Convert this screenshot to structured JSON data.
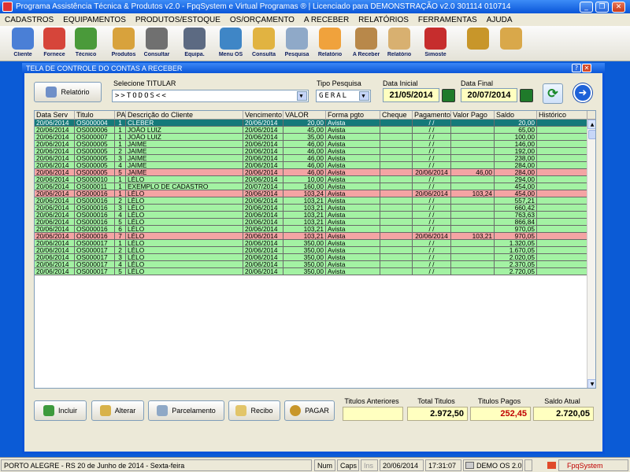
{
  "window": {
    "title": "Programa Assistência Técnica & Produtos v2.0 - FpqSystem e Virtual Programas ® | Licenciado para  DEMONSTRAÇÃO v2.0 301114 010714"
  },
  "menu": [
    "CADASTROS",
    "EQUIPAMENTOS",
    "PRODUTOS/ESTOQUE",
    "OS/ORÇAMENTO",
    "A RECEBER",
    "RELATÓRIOS",
    "FERRAMENTAS",
    "AJUDA"
  ],
  "toolbar": [
    {
      "label": "Cliente",
      "color": "#4a7fd6"
    },
    {
      "label": "Fornece",
      "color": "#d6453a"
    },
    {
      "label": "Técnico",
      "color": "#4a9a3a"
    },
    {
      "label": "Produtos",
      "color": "#d8a23c"
    },
    {
      "label": "Consultar",
      "color": "#707070"
    },
    {
      "label": "Equipa.",
      "color": "#5c6a82"
    },
    {
      "label": "Menu OS",
      "color": "#3f86c6"
    },
    {
      "label": "Consulta",
      "color": "#e1b341"
    },
    {
      "label": "Pesquisa",
      "color": "#8fa9c8"
    },
    {
      "label": "Relatório",
      "color": "#f0a23c"
    },
    {
      "label": "A Receber",
      "color": "#b8884a"
    },
    {
      "label": "Relatório",
      "color": "#d8b070"
    },
    {
      "label": "Simoste",
      "color": "#c62d2d"
    },
    {
      "label": "",
      "color": "#c8962a"
    },
    {
      "label": "",
      "color": "#d9a84a"
    }
  ],
  "dialog": {
    "title": "TELA DE CONTROLE DO CONTAS A RECEBER",
    "relatorio_button": "Relatório",
    "titular_label": "Selecione TITULAR",
    "titular_value": ">>TODOS<<",
    "tipo_label": "Tipo Pesquisa",
    "tipo_value": "GERAL",
    "data_inicial_label": "Data Inicial",
    "data_inicial": "21/05/2014",
    "data_final_label": "Data Final",
    "data_final": "20/07/2014"
  },
  "table": {
    "headers": [
      "Data Serv",
      "Titulo",
      "PA",
      "Descrição do Cliente",
      "Vencimento",
      "VALOR",
      "Forma pgto",
      "Cheque",
      "Pagamento",
      "Valor Pago",
      "Saldo",
      "Histórico"
    ],
    "rows": [
      {
        "s": "sel",
        "c": [
          "20/06/2014",
          "OS000004",
          "1",
          "CLEBER",
          "20/06/2014",
          "20,00",
          "Avista",
          "",
          " / /",
          "",
          "20,00",
          ""
        ]
      },
      {
        "s": "g",
        "c": [
          "20/06/2014",
          "OS000006",
          "1",
          "JOÃO  LUIZ",
          "20/06/2014",
          "45,00",
          "Avista",
          "",
          " / /",
          "",
          "65,00",
          ""
        ]
      },
      {
        "s": "g",
        "c": [
          "20/06/2014",
          "OS000007",
          "1",
          "JOÃO  LUIZ",
          "20/06/2014",
          "35,00",
          "Avista",
          "",
          " / /",
          "",
          "100,00",
          ""
        ]
      },
      {
        "s": "g",
        "c": [
          "20/06/2014",
          "OS000005",
          "1",
          "JAIME",
          "20/06/2014",
          "46,00",
          "Avista",
          "",
          " / /",
          "",
          "146,00",
          ""
        ]
      },
      {
        "s": "g",
        "c": [
          "20/06/2014",
          "OS000005",
          "2",
          "JAIME",
          "20/06/2014",
          "46,00",
          "Avista",
          "",
          " / /",
          "",
          "192,00",
          ""
        ]
      },
      {
        "s": "g",
        "c": [
          "20/06/2014",
          "OS000005",
          "3",
          "JAIME",
          "20/06/2014",
          "46,00",
          "Avista",
          "",
          " / /",
          "",
          "238,00",
          ""
        ]
      },
      {
        "s": "g",
        "c": [
          "20/06/2014",
          "OS000005",
          "4",
          "JAIME",
          "20/06/2014",
          "46,00",
          "Avista",
          "",
          " / /",
          "",
          "284,00",
          ""
        ]
      },
      {
        "s": "p",
        "c": [
          "20/06/2014",
          "OS000005",
          "5",
          "JAIME",
          "20/06/2014",
          "46,00",
          "Avista",
          "",
          "20/06/2014",
          "46,00",
          "284,00",
          ""
        ]
      },
      {
        "s": "g",
        "c": [
          "20/06/2014",
          "OS000010",
          "1",
          "LÉLO",
          "20/06/2014",
          "10,00",
          "Avista",
          "",
          " / /",
          "",
          "294,00",
          ""
        ]
      },
      {
        "s": "g",
        "c": [
          "20/06/2014",
          "OS000011",
          "1",
          "EXEMPLO DE CADASTRO",
          "20/07/2014",
          "160,00",
          "Avista",
          "",
          " / /",
          "",
          "454,00",
          ""
        ]
      },
      {
        "s": "p",
        "c": [
          "20/06/2014",
          "OS000016",
          "1",
          "LÉLO",
          "20/06/2014",
          "103,24",
          "Avista",
          "",
          "20/06/2014",
          "103,24",
          "454,00",
          ""
        ]
      },
      {
        "s": "g",
        "c": [
          "20/06/2014",
          "OS000016",
          "2",
          "LÉLO",
          "20/06/2014",
          "103,21",
          "Avista",
          "",
          " / /",
          "",
          "557,21",
          ""
        ]
      },
      {
        "s": "g",
        "c": [
          "20/06/2014",
          "OS000016",
          "3",
          "LÉLO",
          "20/06/2014",
          "103,21",
          "Avista",
          "",
          " / /",
          "",
          "660,42",
          ""
        ]
      },
      {
        "s": "g",
        "c": [
          "20/06/2014",
          "OS000016",
          "4",
          "LÉLO",
          "20/06/2014",
          "103,21",
          "Avista",
          "",
          " / /",
          "",
          "763,63",
          ""
        ]
      },
      {
        "s": "g",
        "c": [
          "20/06/2014",
          "OS000016",
          "5",
          "LÉLO",
          "20/06/2014",
          "103,21",
          "Avista",
          "",
          " / /",
          "",
          "866,84",
          ""
        ]
      },
      {
        "s": "g",
        "c": [
          "20/06/2014",
          "OS000016",
          "6",
          "LÉLO",
          "20/06/2014",
          "103,21",
          "Avista",
          "",
          " / /",
          "",
          "970,05",
          ""
        ]
      },
      {
        "s": "p",
        "c": [
          "20/06/2014",
          "OS000016",
          "7",
          "LÉLO",
          "20/06/2014",
          "103,21",
          "Avista",
          "",
          "20/06/2014",
          "103,21",
          "970,05",
          ""
        ]
      },
      {
        "s": "g",
        "c": [
          "20/06/2014",
          "OS000017",
          "1",
          "LÉLO",
          "20/06/2014",
          "350,00",
          "Avista",
          "",
          " / /",
          "",
          "1.320,05",
          ""
        ]
      },
      {
        "s": "g",
        "c": [
          "20/06/2014",
          "OS000017",
          "2",
          "LÉLO",
          "20/06/2014",
          "350,00",
          "Avista",
          "",
          " / /",
          "",
          "1.670,05",
          ""
        ]
      },
      {
        "s": "g",
        "c": [
          "20/06/2014",
          "OS000017",
          "3",
          "LÉLO",
          "20/06/2014",
          "350,00",
          "Avista",
          "",
          " / /",
          "",
          "2.020,05",
          ""
        ]
      },
      {
        "s": "g",
        "c": [
          "20/06/2014",
          "OS000017",
          "4",
          "LÉLO",
          "20/06/2014",
          "350,00",
          "Avista",
          "",
          " / /",
          "",
          "2.370,05",
          ""
        ]
      },
      {
        "s": "g",
        "c": [
          "20/06/2014",
          "OS000017",
          "5",
          "LÉLO",
          "20/06/2014",
          "350,00",
          "Avista",
          "",
          " / /",
          "",
          "2.720,05",
          ""
        ]
      }
    ]
  },
  "actions": {
    "incluir": "Incluir",
    "alterar": "Alterar",
    "parcelamento": "Parcelamento",
    "recibo": "Recibo",
    "pagar": "PAGAR"
  },
  "totals": {
    "anteriores_label": "Titulos Anteriores",
    "anteriores": "",
    "total_label": "Total Titulos",
    "total": "2.972,50",
    "pagos_label": "Titulos Pagos",
    "pagos": "252,45",
    "saldo_label": "Saldo Atual",
    "saldo": "2.720,05"
  },
  "status": {
    "location": "PORTO ALEGRE - RS 20 de Junho de 2014 - Sexta-feira",
    "num": "Num",
    "caps": "Caps",
    "ins": "Ins",
    "date": "20/06/2014",
    "time": "17:31:07",
    "demo": "DEMO OS 2.0",
    "brand": "FpqSystem"
  },
  "colors": {
    "row_open": "#a3f2a3",
    "row_paid": "#f4a4a4",
    "row_selected": "#157a7a",
    "pagos_value": "#c00000",
    "titlebar": "#0b57d8"
  }
}
